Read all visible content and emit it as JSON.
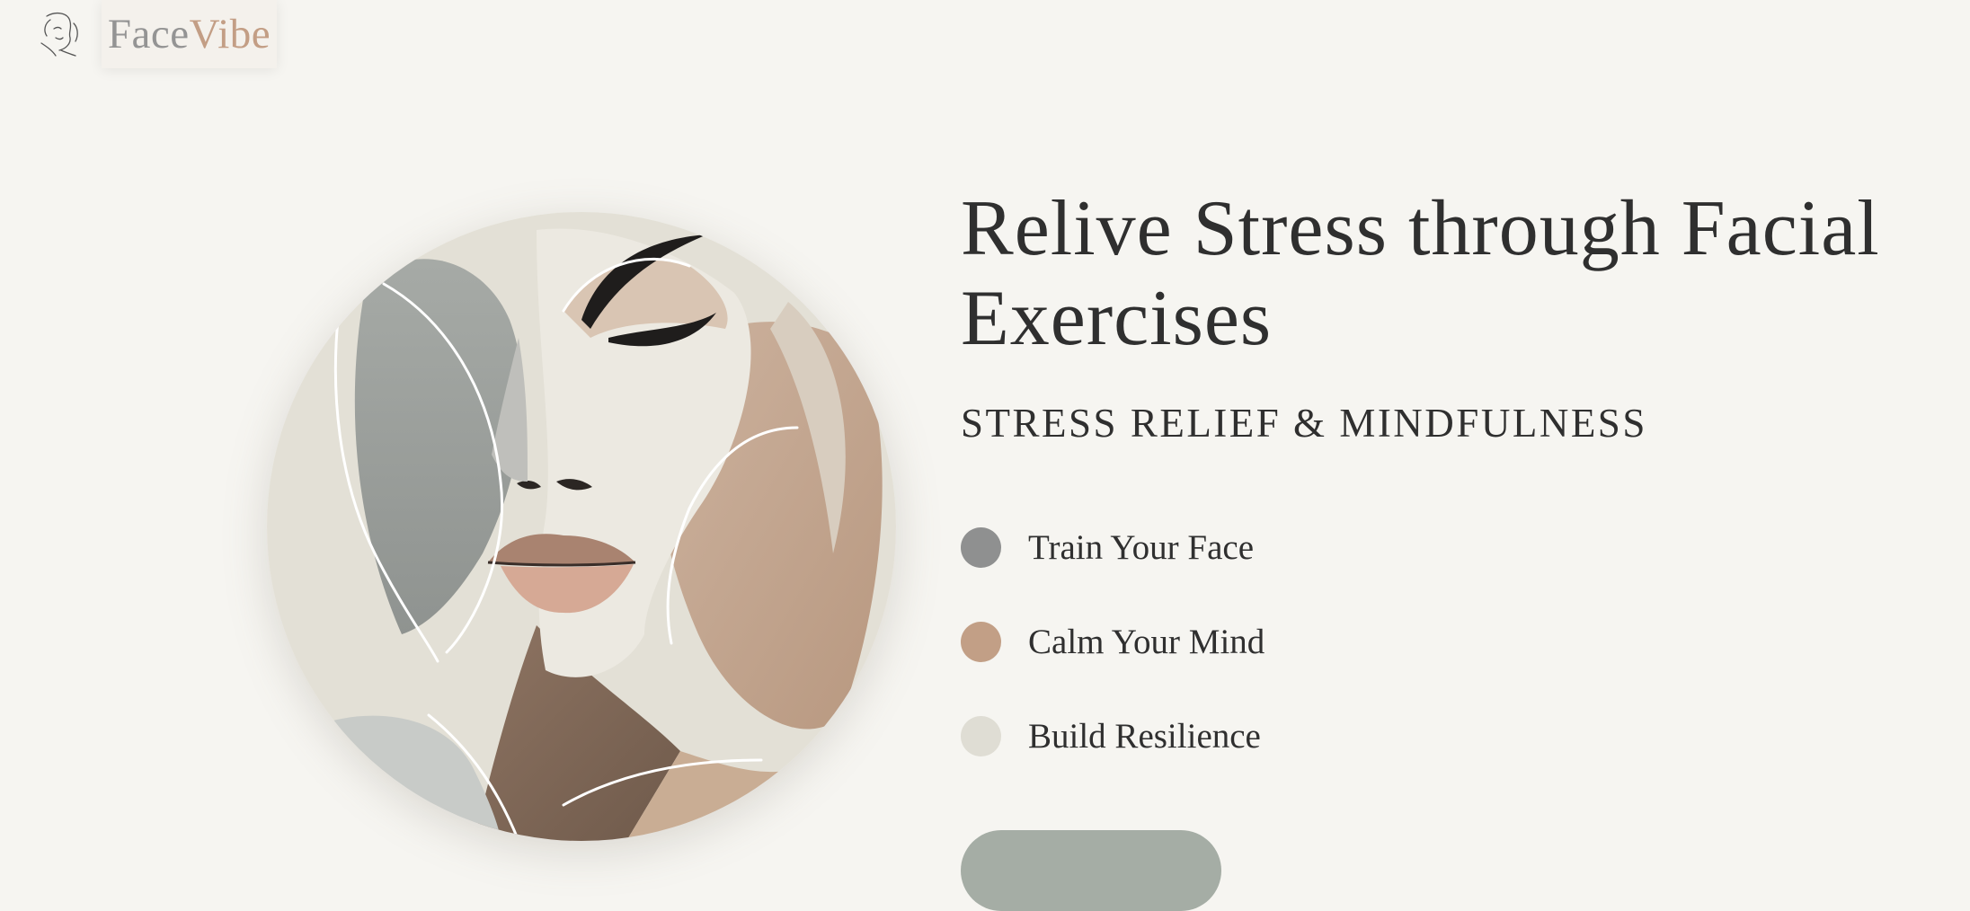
{
  "header": {
    "logo_icon": "face-line-art-icon",
    "brand_part1": "Face",
    "brand_part2": "Vibe",
    "brand_colors": {
      "part1": "#949494",
      "part2": "#c39e85"
    }
  },
  "hero": {
    "image": "abstract-face-illustration",
    "title": "Relive Stress through Facial Exercises",
    "subtitle": "STRESS RELIEF & MINDFULNESS",
    "features": [
      {
        "label": "Train Your Face",
        "color": "#8f9090"
      },
      {
        "label": "Calm Your Mind",
        "color": "#c29f86"
      },
      {
        "label": "Build Resilience",
        "color": "#dfddd4"
      }
    ],
    "cta": {
      "color": "#a5ada5"
    }
  },
  "colors": {
    "background": "#f6f5f1",
    "text": "#2f2f2f"
  }
}
